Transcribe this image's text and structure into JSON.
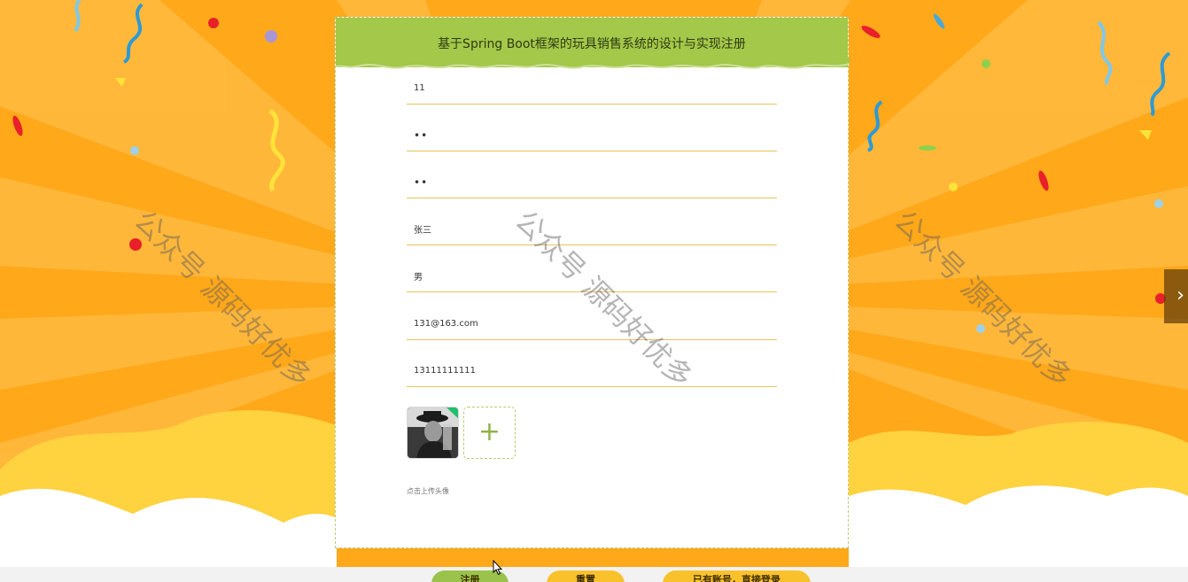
{
  "header": {
    "title": "基于Spring Boot框架的玩具销售系统的设计与实现注册"
  },
  "form": {
    "account": "11",
    "password": "••",
    "confirm_password": "••",
    "name": "张三",
    "gender": "男",
    "email": "131@163.com",
    "phone": "13111111111",
    "upload_plus": "+",
    "upload_hint": "点击上传头像"
  },
  "watermark": {
    "text": "公众号 源码好优多"
  },
  "buttons": {
    "register": "注册",
    "reset": "重置",
    "login": "已有账号，直接登录"
  },
  "carousel": {
    "next": "›"
  },
  "colors": {
    "background": "#ffa81a",
    "header": "#a3c84a",
    "underline": "#e7c45a",
    "button_green": "#9bc24a",
    "button_yellow": "#f9c12c"
  }
}
